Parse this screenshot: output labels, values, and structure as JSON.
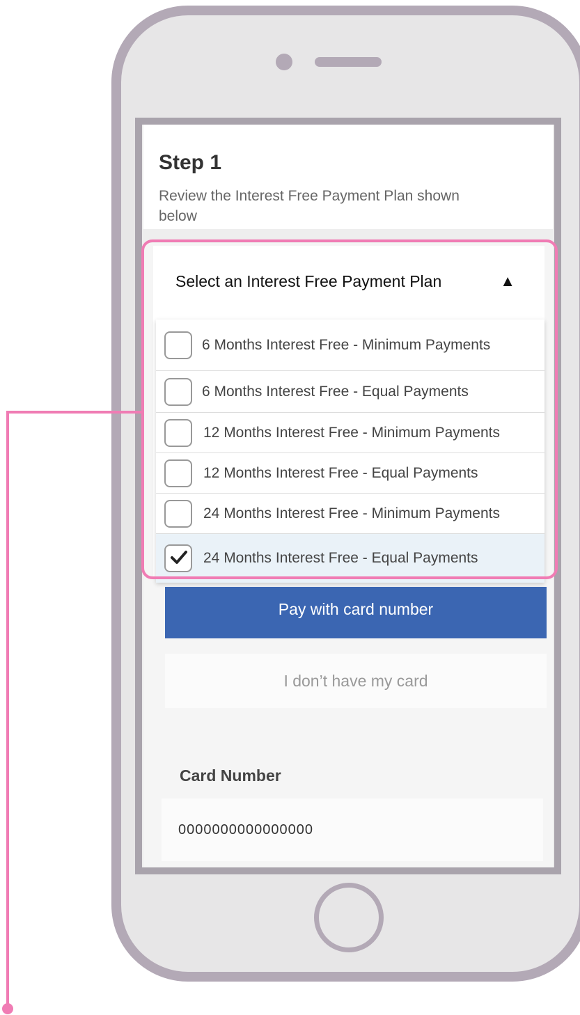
{
  "step": {
    "title": "Step 1",
    "description": "Review the Interest Free Payment Plan shown below"
  },
  "dropdown": {
    "title": "Select an Interest Free Payment Plan",
    "arrow": "▲",
    "options": [
      {
        "label": "6 Months Interest Free - Minimum Payments",
        "checked": false
      },
      {
        "label": "6 Months Interest Free - Equal Payments",
        "checked": false
      },
      {
        "label": "12 Months Interest Free - Minimum Payments",
        "checked": false
      },
      {
        "label": "12 Months Interest Free - Equal Payments",
        "checked": false
      },
      {
        "label": "24 Months Interest Free - Minimum Payments",
        "checked": false
      },
      {
        "label": "24 Months Interest Free - Equal Payments",
        "checked": true
      }
    ]
  },
  "buttons": {
    "pay_label": "Pay with card number",
    "no_card_label": "I don’t have my card"
  },
  "card": {
    "label": "Card Number",
    "value": "0000000000000000"
  },
  "colors": {
    "accent": "#3b66b2",
    "highlight": "#f07cb4",
    "phone_frame": "#b3a9b6"
  },
  "icons": {
    "selected_check": "check-icon",
    "dropdown_arrow": "triangle-up-icon"
  }
}
